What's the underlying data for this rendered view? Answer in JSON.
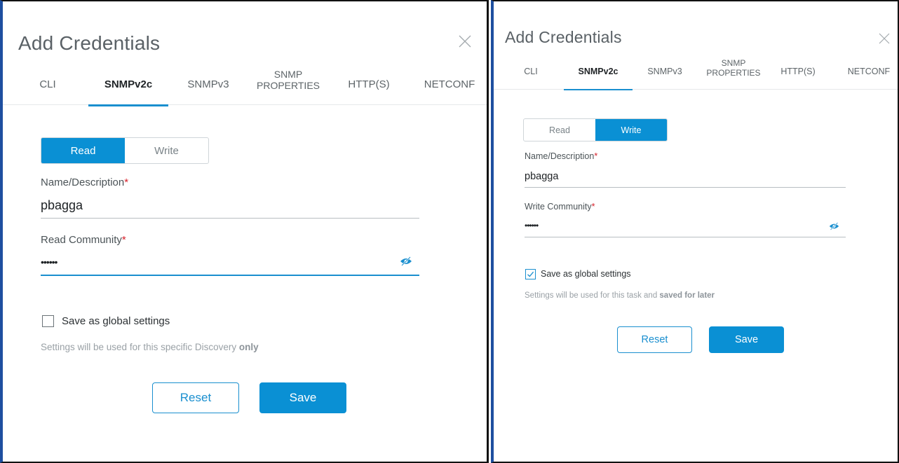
{
  "left": {
    "title": "Add Credentials",
    "close_icon": "close-icon",
    "tabs": [
      {
        "label": "CLI"
      },
      {
        "label": "SNMPv2c"
      },
      {
        "label": "SNMPv3"
      },
      {
        "label": "SNMP\nPROPERTIES"
      },
      {
        "label": "HTTP(S)"
      },
      {
        "label": "NETCONF"
      }
    ],
    "active_tab": "SNMPv2c",
    "mode": {
      "read": "Read",
      "write": "Write",
      "selected": "Read"
    },
    "name_label": "Name/Description",
    "name_value": "pbagga",
    "community_label": "Read Community",
    "community_value": "••••••",
    "required_mark": "*",
    "eye_icon": "eye-slash-icon",
    "global_checkbox_checked": false,
    "global_label": "Save as global settings",
    "note_prefix": "Settings will be used for this specific Discovery ",
    "note_bold": "only",
    "reset_label": "Reset",
    "save_label": "Save"
  },
  "right": {
    "title": "Add Credentials",
    "close_icon": "close-icon",
    "tabs": [
      {
        "label": "CLI"
      },
      {
        "label": "SNMPv2c"
      },
      {
        "label": "SNMPv3"
      },
      {
        "label": "SNMP\nPROPERTIES"
      },
      {
        "label": "HTTP(S)"
      },
      {
        "label": "NETCONF"
      }
    ],
    "active_tab": "SNMPv2c",
    "mode": {
      "read": "Read",
      "write": "Write",
      "selected": "Write"
    },
    "name_label": "Name/Description",
    "name_value": "pbagga",
    "community_label": "Write Community",
    "community_value": "••••••",
    "required_mark": "*",
    "eye_icon": "eye-slash-icon",
    "global_checkbox_checked": true,
    "global_label": "Save as global settings",
    "note_prefix": "Settings will be used for this task and ",
    "note_bold": "saved for later",
    "reset_label": "Reset",
    "save_label": "Save"
  },
  "colors": {
    "accent": "#0a90d4",
    "required": "#d6202a"
  }
}
